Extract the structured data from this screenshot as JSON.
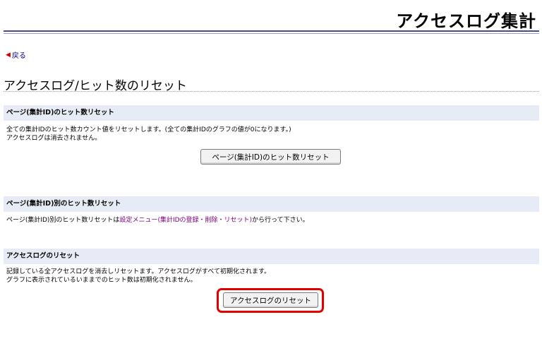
{
  "header": {
    "title": "アクセスログ集計"
  },
  "nav": {
    "back_label": "戻る",
    "back_icon": "back-arrow-icon"
  },
  "page": {
    "heading": "アクセスログ/ヒット数のリセット"
  },
  "sections": [
    {
      "title": "ページ(集計ID)のヒット数リセット",
      "lines": [
        "全ての集計IDのヒット数カウント値をリセットします。(全ての集計IDのグラフの値が0になります。)",
        "アクセスログは消去されません。"
      ],
      "button_label": "ページ(集計ID)のヒット数リセット"
    },
    {
      "title": "ページ(集計ID)別のヒット数リセット",
      "text_before": "ページ(集計ID)別のヒット数リセットは",
      "link_label": "設定メニュー(集計IDの登録・削除・リセット)",
      "text_after": "から行って下さい。"
    },
    {
      "title": "アクセスログのリセット",
      "lines": [
        "記録している全アクセスログを消去しリセットます。アクセスログがすべて初期化されます。",
        "グラフに表示されているいままでのヒット数は初期化されません。"
      ],
      "button_label": "アクセスログのリセット"
    }
  ],
  "colors": {
    "accent_rule": "#4a4a8c",
    "section_bg": "#e6ebf5",
    "highlight": "#e00000",
    "link": "#800080"
  }
}
